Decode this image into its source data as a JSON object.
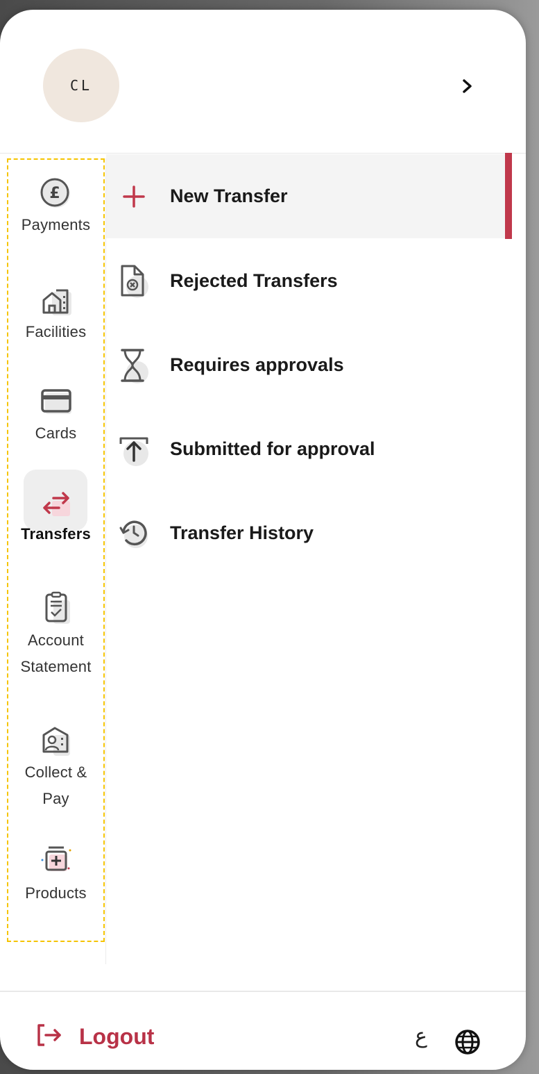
{
  "header": {
    "avatar_initials": "CL",
    "chevron_icon": "chevron-right-icon"
  },
  "rail": {
    "items": [
      {
        "label": "Payments",
        "icon": "pound-coin-icon"
      },
      {
        "label": "Facilities",
        "icon": "building-icon"
      },
      {
        "label": "Cards",
        "icon": "card-icon"
      },
      {
        "label": "Transfers",
        "icon": "transfer-arrows-icon",
        "active": true
      },
      {
        "label": "Account Statement",
        "label_lines": [
          "Account",
          "Statement"
        ],
        "icon": "clipboard-check-icon"
      },
      {
        "label": "Collect & Pay",
        "label_lines": [
          "Collect &",
          "Pay"
        ],
        "icon": "collect-pay-icon"
      },
      {
        "label": "Products",
        "icon": "products-icon"
      }
    ]
  },
  "menu": {
    "items": [
      {
        "label": "New Transfer",
        "icon": "plus-icon",
        "active": true
      },
      {
        "label": "Rejected Transfers",
        "icon": "rejected-doc-icon"
      },
      {
        "label": "Requires approvals",
        "icon": "hourglass-icon"
      },
      {
        "label": "Submitted for approval",
        "icon": "upload-icon"
      },
      {
        "label": "Transfer History",
        "icon": "history-icon"
      }
    ]
  },
  "footer": {
    "logout_label": "Logout",
    "language_label": "ع",
    "globe_icon": "globe-icon"
  },
  "colors": {
    "accent": "#c0384b",
    "logout": "#b83247",
    "avatar_bg": "#f0e7de",
    "highlight": "#f5c400"
  }
}
